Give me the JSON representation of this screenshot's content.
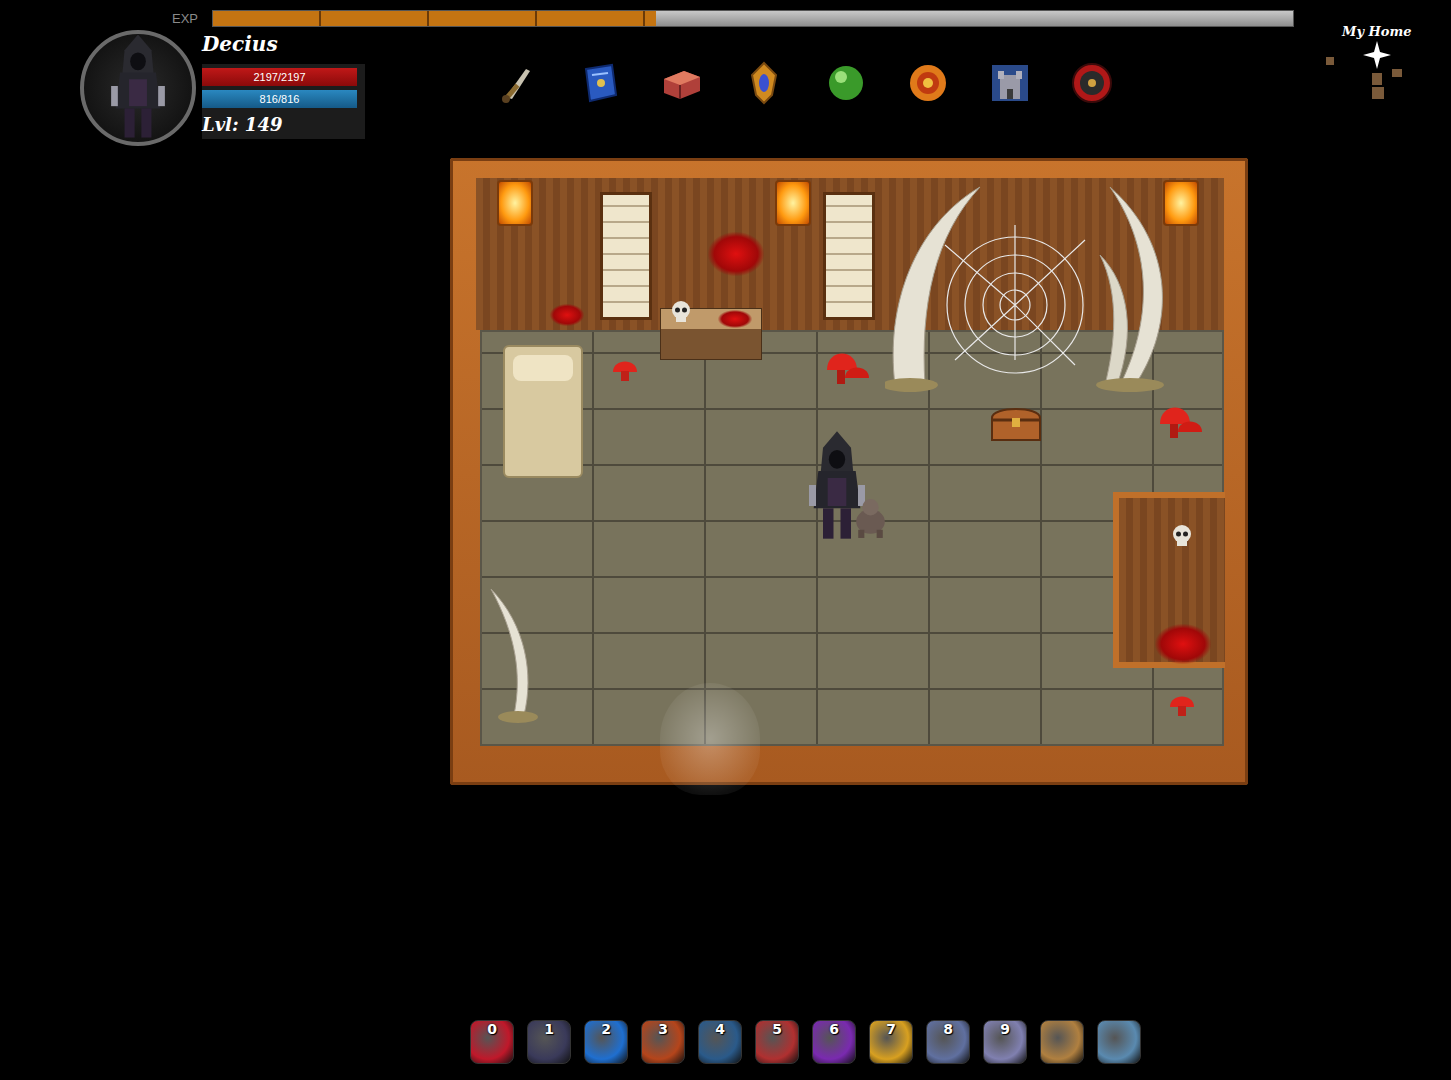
{
  "hud": {
    "exp": {
      "label": "EXP",
      "level": 0.41
    },
    "player": {
      "name": "Decius",
      "hp": {
        "reading": "2197/2197",
        "level": 1
      },
      "mp": {
        "reading": "816/816",
        "level": 1
      },
      "level": "Lvl: 149"
    }
  },
  "location": {
    "title": "My Home"
  },
  "hotbar": [
    {
      "key": "0"
    },
    {
      "key": "1"
    },
    {
      "key": "2"
    },
    {
      "key": "3"
    },
    {
      "key": "4"
    },
    {
      "key": "5"
    },
    {
      "key": "6"
    },
    {
      "key": "7"
    },
    {
      "key": "8"
    },
    {
      "key": "9"
    },
    {
      "key": null
    },
    {
      "key": null
    }
  ]
}
